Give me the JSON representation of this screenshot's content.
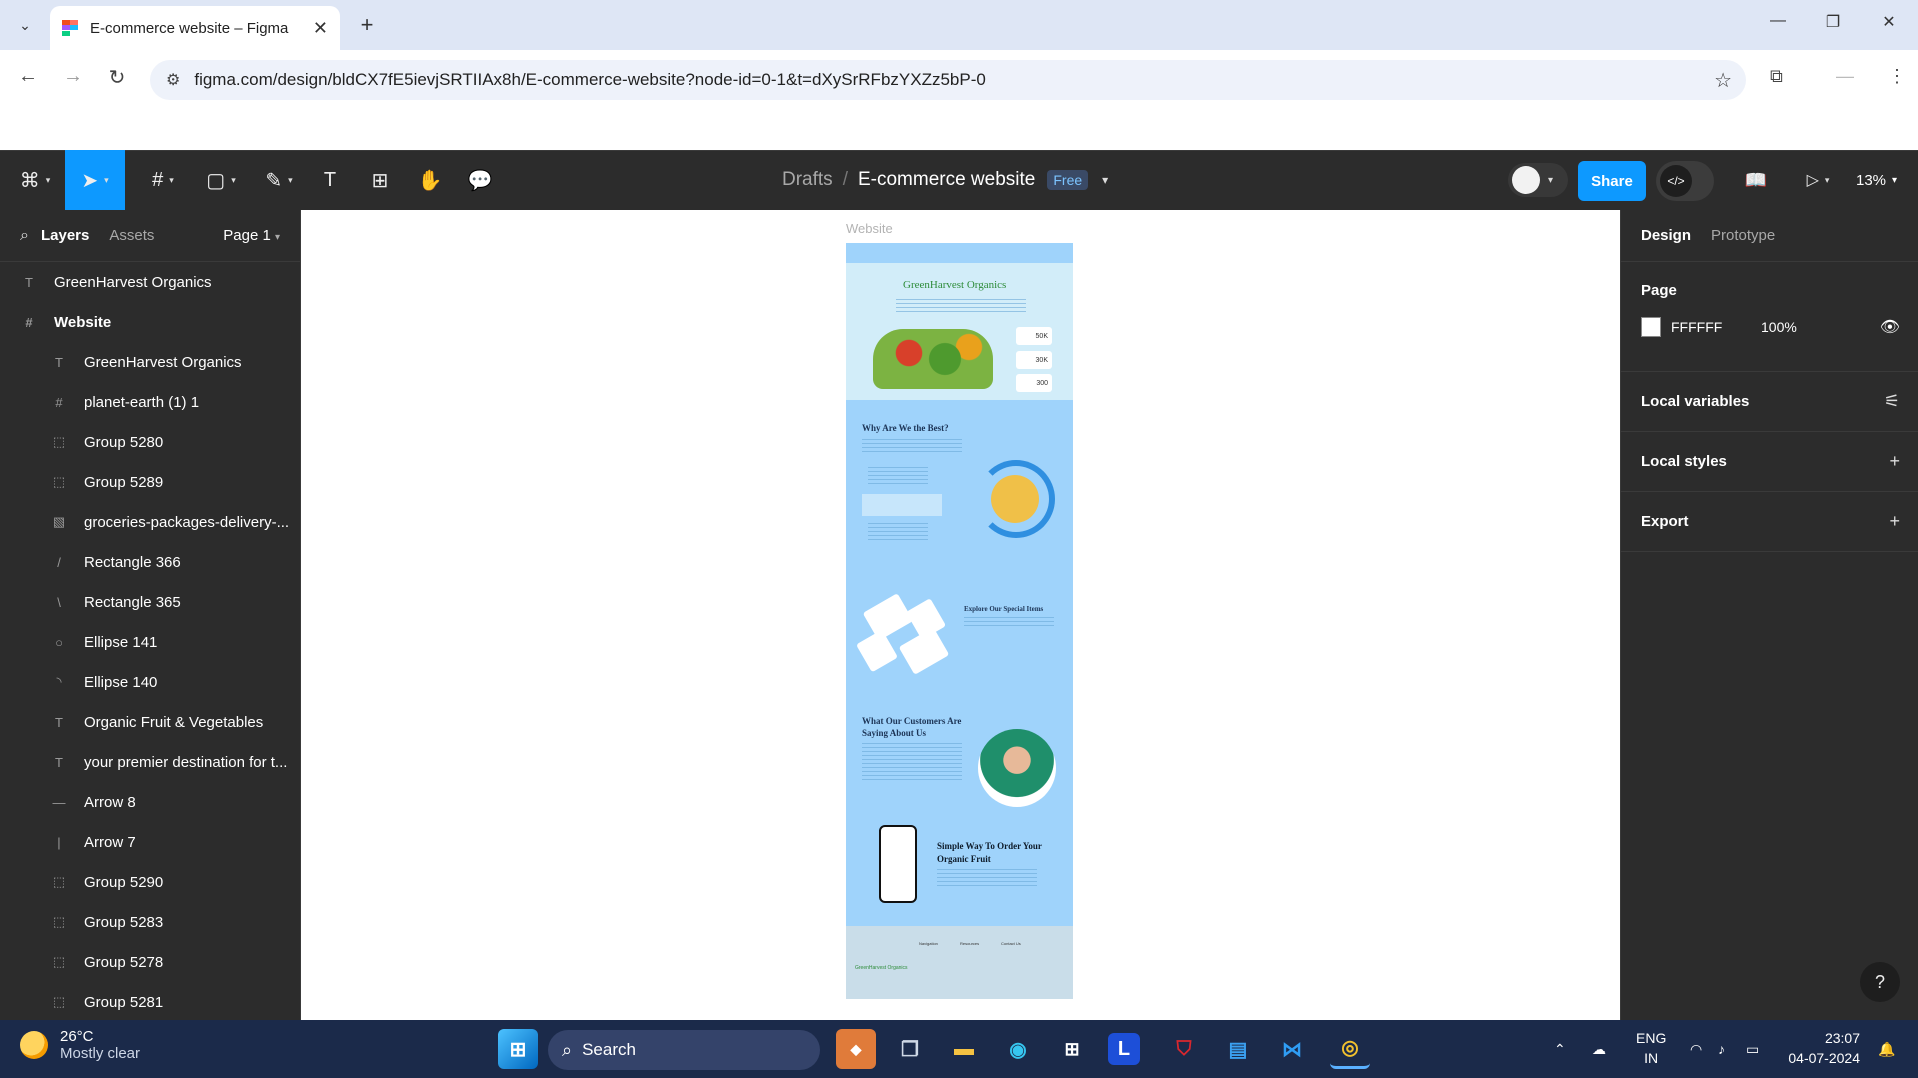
{
  "browser": {
    "tab_title": "E-commerce website – Figma",
    "url": "figma.com/design/bldCX7fE5ievjSRTIIAx8h/E-commerce-website?node-id=0-1&t=dXySrRFbzYXZz5bP-0"
  },
  "figma": {
    "breadcrumb_drafts": "Drafts",
    "breadcrumb_sep": "/",
    "file_name": "E-commerce website",
    "plan_badge": "Free",
    "share_label": "Share",
    "zoom_level": "13%",
    "icons": {
      "main_menu": "figma-logo-icon",
      "move": "cursor-arrow-icon",
      "frame": "hash-frame-icon",
      "shape": "rectangle-icon",
      "pen": "pen-icon",
      "text": "text-T-icon",
      "resources": "resources-icon",
      "hand": "hand-icon",
      "comment": "comment-icon",
      "dev_mode": "code-brackets-icon",
      "library": "book-icon",
      "present": "present-icon"
    }
  },
  "left_panel": {
    "tab_layers": "Layers",
    "tab_assets": "Assets",
    "page_selector": "Page 1",
    "layers": [
      {
        "icon": "T",
        "name": "GreenHarvest Organics",
        "level": 0
      },
      {
        "icon": "#",
        "name": "Website",
        "level": 0,
        "bold": true
      },
      {
        "icon": "T",
        "name": "GreenHarvest Organics",
        "level": 1
      },
      {
        "icon": "#",
        "name": "planet-earth (1) 1",
        "level": 1
      },
      {
        "icon": "⬚",
        "name": "Group 5280",
        "level": 1
      },
      {
        "icon": "⬚",
        "name": "Group 5289",
        "level": 1
      },
      {
        "icon": "▧",
        "name": "groceries-packages-delivery-...",
        "level": 1
      },
      {
        "icon": "/",
        "name": "Rectangle 366",
        "level": 1
      },
      {
        "icon": "\\",
        "name": "Rectangle 365",
        "level": 1
      },
      {
        "icon": "○",
        "name": "Ellipse 141",
        "level": 1
      },
      {
        "icon": "◝",
        "name": "Ellipse 140",
        "level": 1
      },
      {
        "icon": "T",
        "name": "Organic Fruit & Vegetables",
        "level": 1
      },
      {
        "icon": "T",
        "name": "your premier destination for t...",
        "level": 1
      },
      {
        "icon": "—",
        "name": "Arrow 8",
        "level": 1
      },
      {
        "icon": "|",
        "name": "Arrow 7",
        "level": 1
      },
      {
        "icon": "⬚",
        "name": "Group 5290",
        "level": 1
      },
      {
        "icon": "⬚",
        "name": "Group 5283",
        "level": 1
      },
      {
        "icon": "⬚",
        "name": "Group 5278",
        "level": 1
      },
      {
        "icon": "⬚",
        "name": "Group 5281",
        "level": 1
      }
    ]
  },
  "canvas": {
    "frame_label": "Website",
    "design": {
      "brand": "GreenHarvest Organics",
      "stats": [
        "50K",
        "30K",
        "300"
      ],
      "why_title": "Why Are We the Best?",
      "explore_title": "Explore Our Special Items",
      "customers_title": "What Our Customers Are Saying About Us",
      "order_title": "Simple Way To Order Your Organic Fruit",
      "footer_brand": "GreenHarvest Organics",
      "footer_cols": [
        "Navigation",
        "Resources",
        "Contact Us"
      ]
    }
  },
  "right_panel": {
    "tab_design": "Design",
    "tab_prototype": "Prototype",
    "page_heading": "Page",
    "page_color": "FFFFFF",
    "page_opacity": "100%",
    "local_variables": "Local variables",
    "local_styles": "Local styles",
    "export": "Export",
    "help": "?"
  },
  "taskbar": {
    "temperature": "26°C",
    "condition": "Mostly clear",
    "search_placeholder": "Search",
    "lang_top": "ENG",
    "lang_bottom": "IN",
    "time": "23:07",
    "date": "04-07-2024"
  }
}
